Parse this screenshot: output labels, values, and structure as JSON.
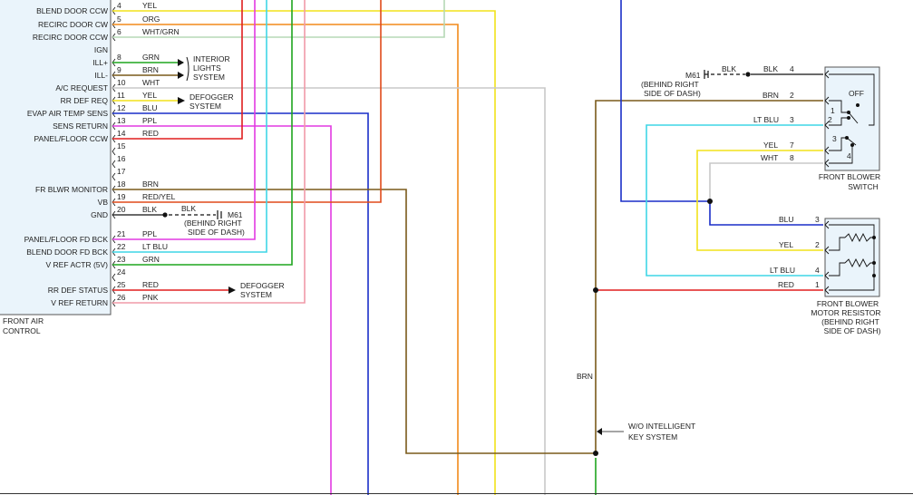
{
  "colors": {
    "YEL": "#f2e21a",
    "ORG": "#f28a1a",
    "WHTGRN": "#b5d8b5",
    "GRN": "#1fa51f",
    "BRN": "#7a5a1a",
    "WHT": "#c8c8c8",
    "BLU": "#1a2fc8",
    "PPL": "#e23ae2",
    "RED": "#e01e1e",
    "REDYEL": "#e04a1a",
    "PNK": "#f09aa8",
    "LTBLU": "#3fd6e6",
    "BLK": "#111111",
    "box_fill": "#eaf4fb",
    "box_stroke": "#555555"
  },
  "front_air_control": {
    "title_line1": "FRONT AIR",
    "title_line2": "CONTROL",
    "pins": [
      {
        "pin": "4",
        "label": "BLEND DOOR CCW",
        "wire": "YEL"
      },
      {
        "pin": "5",
        "label": "RECIRC DOOR CW",
        "wire": "ORG"
      },
      {
        "pin": "6",
        "label": "RECIRC DOOR CCW",
        "wire": "WHT/GRN"
      },
      {
        "pin": "",
        "label": "IGN",
        "wire": ""
      },
      {
        "pin": "8",
        "label": "ILL+",
        "wire": "GRN"
      },
      {
        "pin": "9",
        "label": "ILL-",
        "wire": "BRN"
      },
      {
        "pin": "10",
        "label": "A/C REQUEST",
        "wire": "WHT"
      },
      {
        "pin": "11",
        "label": "RR DEF REQ",
        "wire": "YEL"
      },
      {
        "pin": "12",
        "label": "EVAP AIR TEMP SENS",
        "wire": "BLU"
      },
      {
        "pin": "13",
        "label": "SENS RETURN",
        "wire": "PPL"
      },
      {
        "pin": "14",
        "label": "PANEL/FLOOR CCW",
        "wire": "RED"
      },
      {
        "pin": "15",
        "label": "",
        "wire": ""
      },
      {
        "pin": "16",
        "label": "",
        "wire": ""
      },
      {
        "pin": "17",
        "label": "",
        "wire": ""
      },
      {
        "pin": "18",
        "label": "FR BLWR MONITOR",
        "wire": "BRN"
      },
      {
        "pin": "19",
        "label": "VB",
        "wire": "RED/YEL"
      },
      {
        "pin": "20",
        "label": "GND",
        "wire": "BLK"
      },
      {
        "pin": "21",
        "label": "PANEL/FLOOR FD BCK",
        "wire": "PPL"
      },
      {
        "pin": "22",
        "label": "BLEND DOOR FD BCK",
        "wire": "LT BLU"
      },
      {
        "pin": "23",
        "label": "V REF ACTR (5V)",
        "wire": "GRN"
      },
      {
        "pin": "24",
        "label": "",
        "wire": ""
      },
      {
        "pin": "25",
        "label": "RR DEF STATUS",
        "wire": "RED"
      },
      {
        "pin": "26",
        "label": "V REF RETURN",
        "wire": "PNK"
      }
    ]
  },
  "annotations": {
    "interior_lights": [
      "INTERIOR",
      "LIGHTS",
      "SYSTEM"
    ],
    "defogger_top": [
      "DEFOGGER",
      "SYSTEM"
    ],
    "defogger_bottom": [
      "DEFOGGER",
      "SYSTEM"
    ],
    "m61_left": "M61",
    "m61_left_note": [
      "(BEHIND RIGHT",
      "SIDE OF DASH)"
    ],
    "m61_left_wire": "BLK",
    "m61_right": "M61",
    "m61_right_note": [
      "(BEHIND RIGHT",
      "SIDE OF DASH)"
    ],
    "m61_right_wire_a": "BLK",
    "m61_right_wire_b": "BLK",
    "brn_vertical": "BRN",
    "intelligent_key": [
      "W/O INTELLIGENT",
      "KEY SYSTEM"
    ]
  },
  "front_blower_switch": {
    "title": [
      "FRONT BLOWER",
      "SWITCH"
    ],
    "off_label": "OFF",
    "inner": [
      "1",
      "2",
      "3",
      "4"
    ],
    "pins": [
      {
        "pin": "4",
        "wire": "BLK"
      },
      {
        "pin": "2",
        "wire": "BRN"
      },
      {
        "pin": "3",
        "wire": "LT BLU"
      },
      {
        "pin": "7",
        "wire": "YEL"
      },
      {
        "pin": "8",
        "wire": "WHT"
      }
    ]
  },
  "front_blower_resistor": {
    "title": [
      "FRONT BLOWER",
      "MOTOR RESISTOR",
      "(BEHIND RIGHT",
      "SIDE OF DASH)"
    ],
    "pins": [
      {
        "pin": "3",
        "wire": "BLU"
      },
      {
        "pin": "2",
        "wire": "YEL"
      },
      {
        "pin": "4",
        "wire": "LT BLU"
      },
      {
        "pin": "1",
        "wire": "RED"
      }
    ]
  }
}
